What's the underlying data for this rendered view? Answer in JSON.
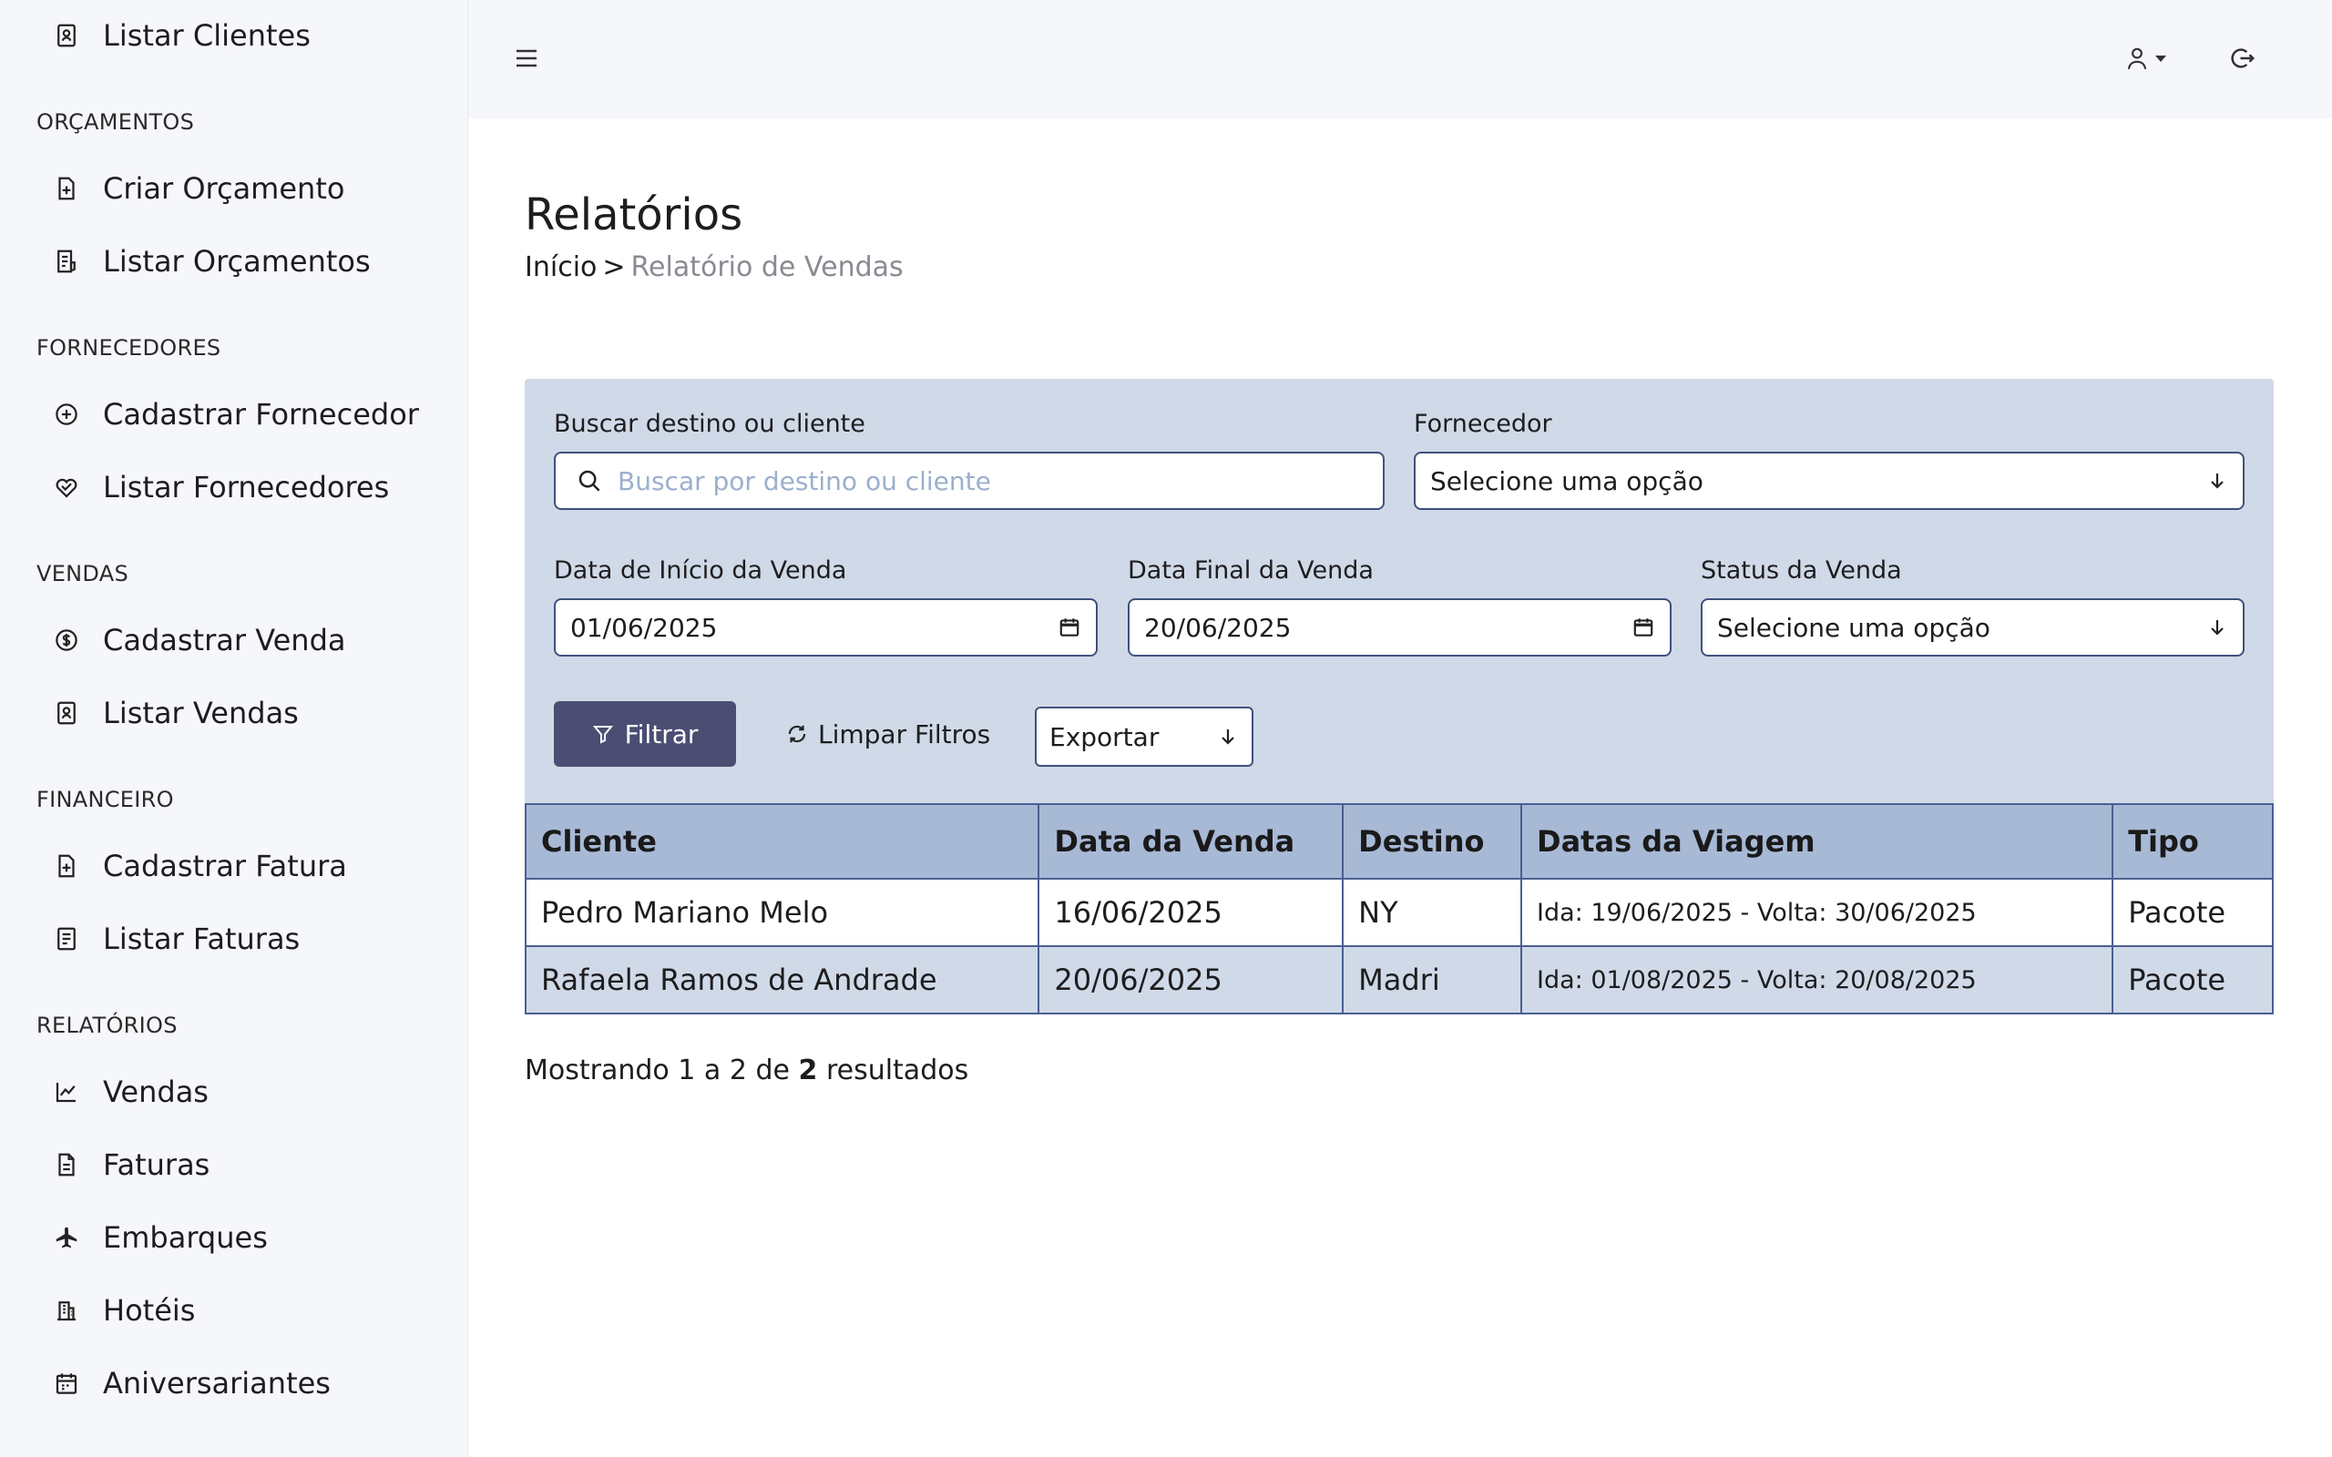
{
  "sidebar": {
    "items": [
      {
        "label": "Listar Clientes",
        "icon": "contact-book-icon"
      },
      {
        "label": "Criar Orçamento",
        "icon": "file-add-icon"
      },
      {
        "label": "Listar Orçamentos",
        "icon": "file-list-icon"
      },
      {
        "label": "Cadastrar Fornecedor",
        "icon": "add-circle-icon"
      },
      {
        "label": "Listar Fornecedores",
        "icon": "handshake-icon"
      },
      {
        "label": "Cadastrar Venda",
        "icon": "money-icon"
      },
      {
        "label": "Listar Vendas",
        "icon": "contact-book-icon"
      },
      {
        "label": "Cadastrar Fatura",
        "icon": "file-add-icon"
      },
      {
        "label": "Listar Faturas",
        "icon": "file-text-icon"
      },
      {
        "label": "Vendas",
        "icon": "line-chart-icon"
      },
      {
        "label": "Faturas",
        "icon": "document-icon"
      },
      {
        "label": "Embarques",
        "icon": "plane-icon"
      },
      {
        "label": "Hotéis",
        "icon": "building-icon"
      },
      {
        "label": "Aniversariantes",
        "icon": "calendar-icon"
      }
    ],
    "sections": {
      "orcamentos": "ORÇAMENTOS",
      "fornecedores": "FORNECEDORES",
      "vendas": "VENDAS",
      "financeiro": "FINANCEIRO",
      "relatorios": "RELATÓRIOS"
    }
  },
  "topbar": {
    "menu_icon": "hamburger-icon",
    "user_icon": "user-icon",
    "logout_icon": "logout-icon"
  },
  "page": {
    "title": "Relatórios",
    "breadcrumb": {
      "home": "Início",
      "separator": ">",
      "current": "Relatório de Vendas"
    }
  },
  "filters": {
    "search": {
      "label": "Buscar destino ou cliente",
      "placeholder": "Buscar por destino ou cliente",
      "value": ""
    },
    "supplier": {
      "label": "Fornecedor",
      "value": "Selecione uma opção"
    },
    "start_date": {
      "label": "Data de Início da Venda",
      "value": "01/06/2025"
    },
    "end_date": {
      "label": "Data Final da Venda",
      "value": "20/06/2025"
    },
    "status": {
      "label": "Status da Venda",
      "value": "Selecione uma opção"
    },
    "filter_button": "Filtrar",
    "clear_button": "Limpar Filtros",
    "export": "Exportar"
  },
  "table": {
    "headers": [
      "Cliente",
      "Data da Venda",
      "Destino",
      "Datas da Viagem",
      "Tipo"
    ],
    "rows": [
      [
        "Pedro Mariano Melo",
        "16/06/2025",
        "NY",
        "Ida: 19/06/2025 - Volta: 30/06/2025",
        "Pacote"
      ],
      [
        "Rafaela Ramos de Andrade",
        "20/06/2025",
        "Madri",
        "Ida: 01/08/2025 - Volta: 20/08/2025",
        "Pacote"
      ]
    ]
  },
  "pagination": {
    "prefix": "Mostrando 1 a 2 de",
    "total": "2",
    "suffix": "resultados"
  },
  "colors": {
    "sidebar_bg": "#f6f7fb",
    "panel_bg": "#d0d9e7",
    "header_bg": "#a8b9d6",
    "primary_button": "#4b4e72",
    "border": "#3f517d"
  }
}
